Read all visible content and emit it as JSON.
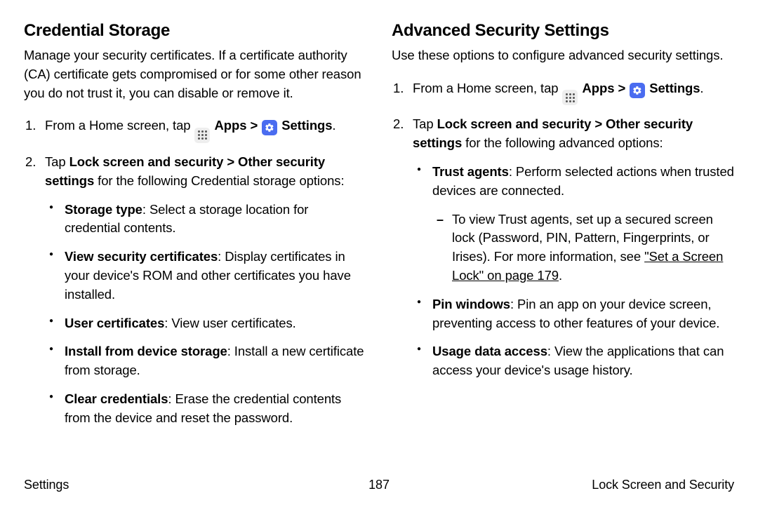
{
  "left": {
    "heading": "Credential Storage",
    "intro": "Manage your security certificates. If a certificate authority (CA) certificate gets compromised or for some other reason you do not trust it, you can disable or remove it.",
    "step1_pre": "From a Home screen, tap ",
    "apps_label": "Apps",
    "chevron": " > ",
    "settings_label": "Settings",
    "period": ".",
    "step2_pre": "Tap ",
    "step2_bold": "Lock screen and security > Other security settings",
    "step2_post": " for the following Credential storage options:",
    "bullets": [
      {
        "label": "Storage type",
        "text": ": Select a storage location for credential contents."
      },
      {
        "label": "View security certificates",
        "text": ": Display certificates in your device's ROM and other certificates you have installed."
      },
      {
        "label": "User certificates",
        "text": ": View user certificates."
      },
      {
        "label": "Install from device storage",
        "text": ": Install a new certificate from storage."
      },
      {
        "label": "Clear credentials",
        "text": ": Erase the credential contents from the device and reset the password."
      }
    ]
  },
  "right": {
    "heading": "Advanced Security Settings",
    "intro": "Use these options to configure advanced security settings.",
    "step1_pre": "From a Home screen, tap ",
    "apps_label": "Apps",
    "chevron": " > ",
    "settings_label": "Settings",
    "period": ".",
    "step2_pre": "Tap ",
    "step2_bold": "Lock screen and security > Other security settings",
    "step2_post": " for the following advanced options:",
    "bullets_1": {
      "label": "Trust agents",
      "text": ": Perform selected actions when trusted devices are connected."
    },
    "sub_pre": "To view Trust agents, set up a secured screen lock (Password, PIN, Pattern, Fingerprints, or Irises). For more information, see ",
    "sub_link": "\"Set a Screen Lock\" on page 179",
    "sub_post": ".",
    "bullets_2": {
      "label": "Pin windows",
      "text": ": Pin an app on your device screen, preventing access to other features of your device."
    },
    "bullets_3": {
      "label": "Usage data access",
      "text": ": View the applications that can access your device's usage history."
    }
  },
  "footer": {
    "left": "Settings",
    "center": "187",
    "right": "Lock Screen and Security"
  }
}
